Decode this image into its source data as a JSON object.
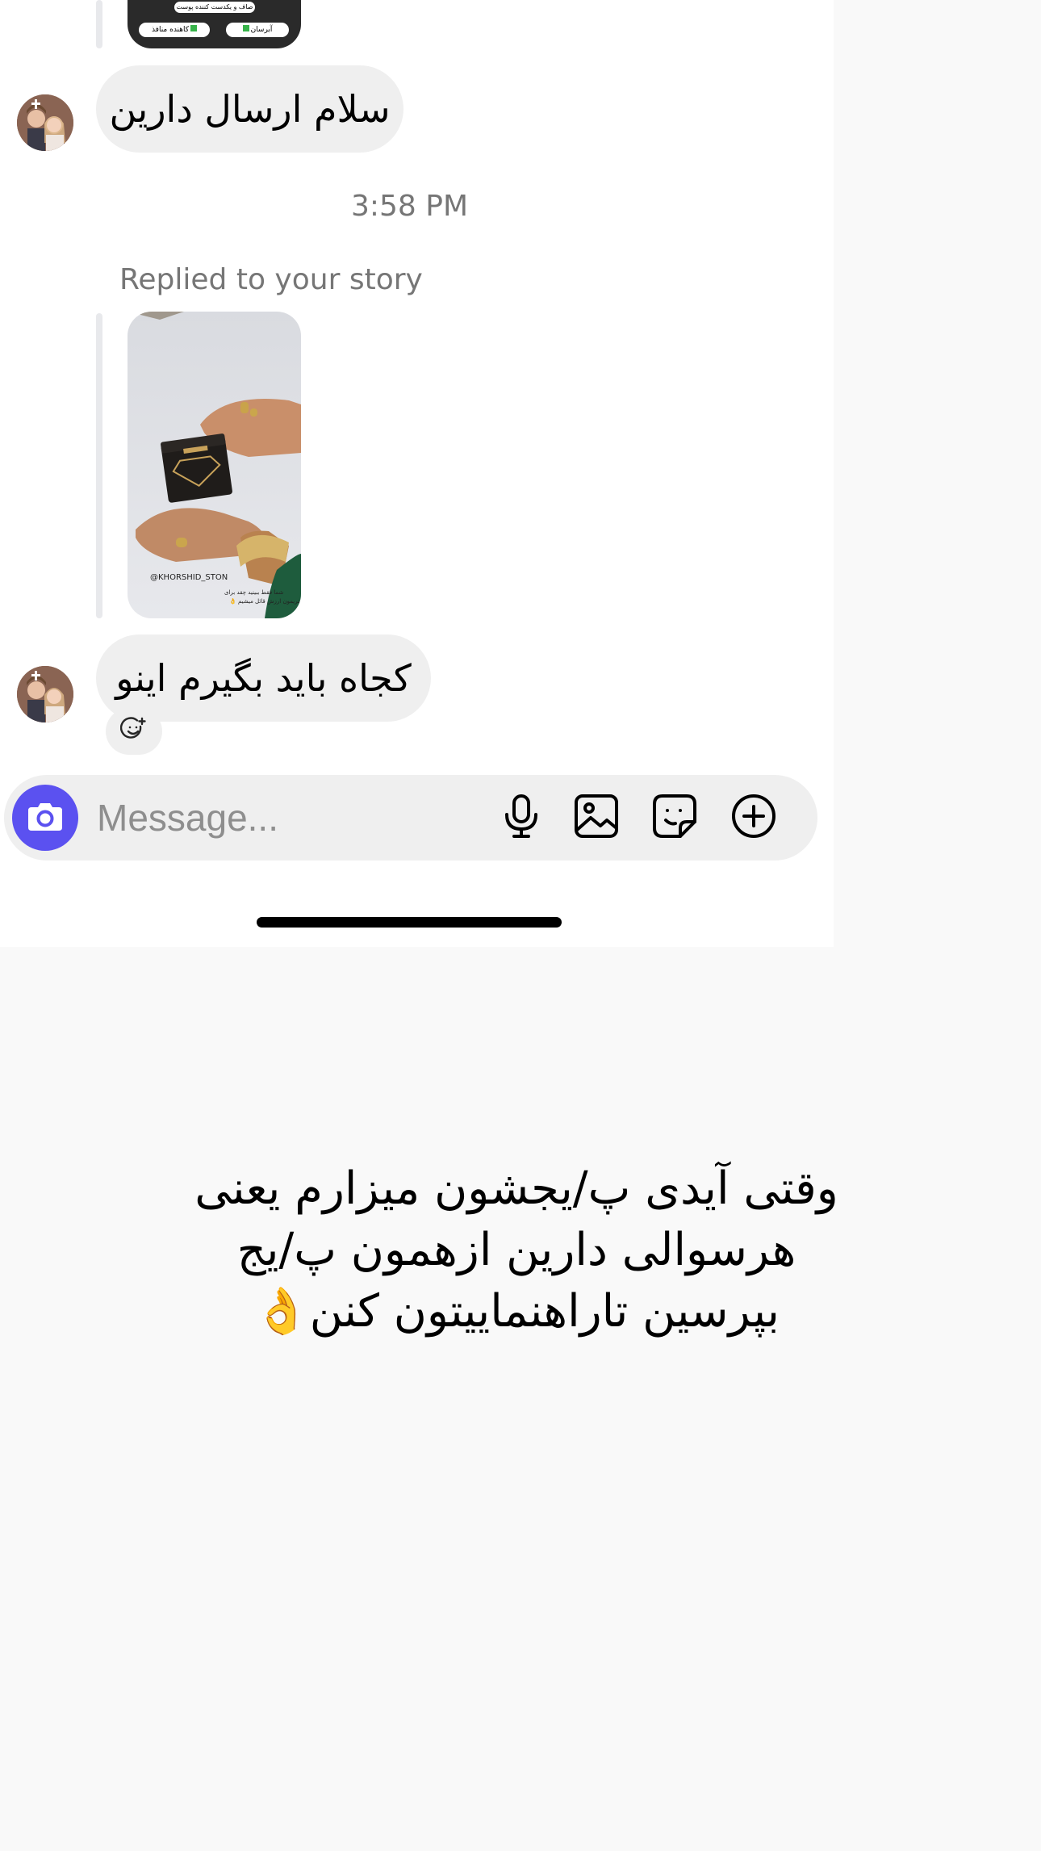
{
  "messages": [
    {
      "text": "سلام ارسال دارین"
    },
    {
      "text": "کجاه باید بگیرم اینو"
    }
  ],
  "top_story": {
    "chip_1": "صاف و یکدست کننده پوست",
    "chip_2": "کاهنده منافذ",
    "chip_3": "آبرسان"
  },
  "timestamp": "3:58 PM",
  "replied_label": "Replied to your story",
  "story": {
    "handle": "@KHORSHID_STON",
    "caption_1": "شما فقط ببینید چقد برای",
    "caption_2": "مشتریمون ارزش قائل میشیم 👌"
  },
  "composer": {
    "placeholder": "Message..."
  },
  "icons": [
    "camera-icon",
    "microphone-icon",
    "gallery-icon",
    "sticker-icon",
    "plus-icon",
    "add-reaction-icon",
    "avatar"
  ],
  "accent_color": "#5b51f0",
  "caption_lines": [
    "وقتی آیدی پ/یجشون میزارم یعنی",
    "هرسوالی دارین ازهمون پ/یج",
    "بپرسین تاراهنماییتون کنن👌"
  ]
}
